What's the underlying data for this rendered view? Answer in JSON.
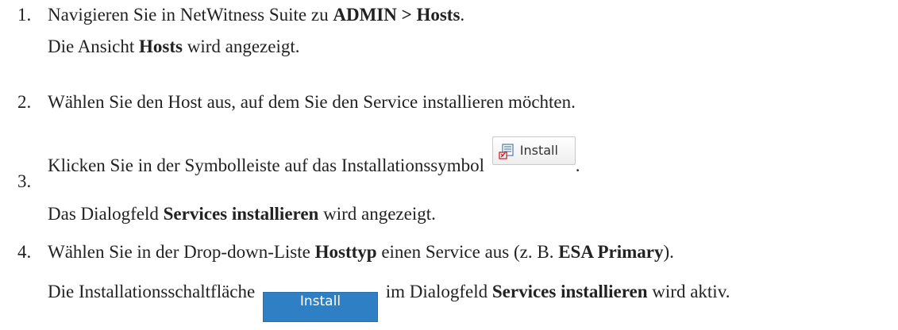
{
  "steps": [
    {
      "number": "1.",
      "line1": {
        "t1": "Navigieren Sie in NetWitness Suite zu ",
        "b1": "ADMIN > Hosts",
        "t2": "."
      },
      "line2": {
        "t1": "Die Ansicht ",
        "b1": "Hosts",
        "t2": " wird angezeigt."
      }
    },
    {
      "number": "2.",
      "line1": {
        "t1": "Wählen Sie den Host aus, auf dem Sie den Service installieren möchten."
      }
    },
    {
      "number": "3.",
      "line1": {
        "t1": "Klicken Sie in der Symbolleiste auf das Installationssymbol ",
        "t2": "."
      },
      "button": {
        "label": "Install",
        "icon": "install-icon"
      },
      "line2": {
        "t1": "Das Dialogfeld ",
        "b1": "Services installieren",
        "t2": " wird angezeigt."
      }
    },
    {
      "number": "4.",
      "line1": {
        "t1": "Wählen Sie in der Drop-down-Liste ",
        "b1": "Hosttyp",
        "t2": " einen Service aus (z. B. ",
        "b2": "ESA Primary",
        "t3": ")."
      },
      "line2": {
        "t1": "Die Installationsschaltfläche ",
        "t2": " im Dialogfeld ",
        "b1": "Services installieren",
        "t3": " wird aktiv."
      },
      "button": {
        "label": "Install",
        "color": "#2e7fc3"
      }
    }
  ]
}
